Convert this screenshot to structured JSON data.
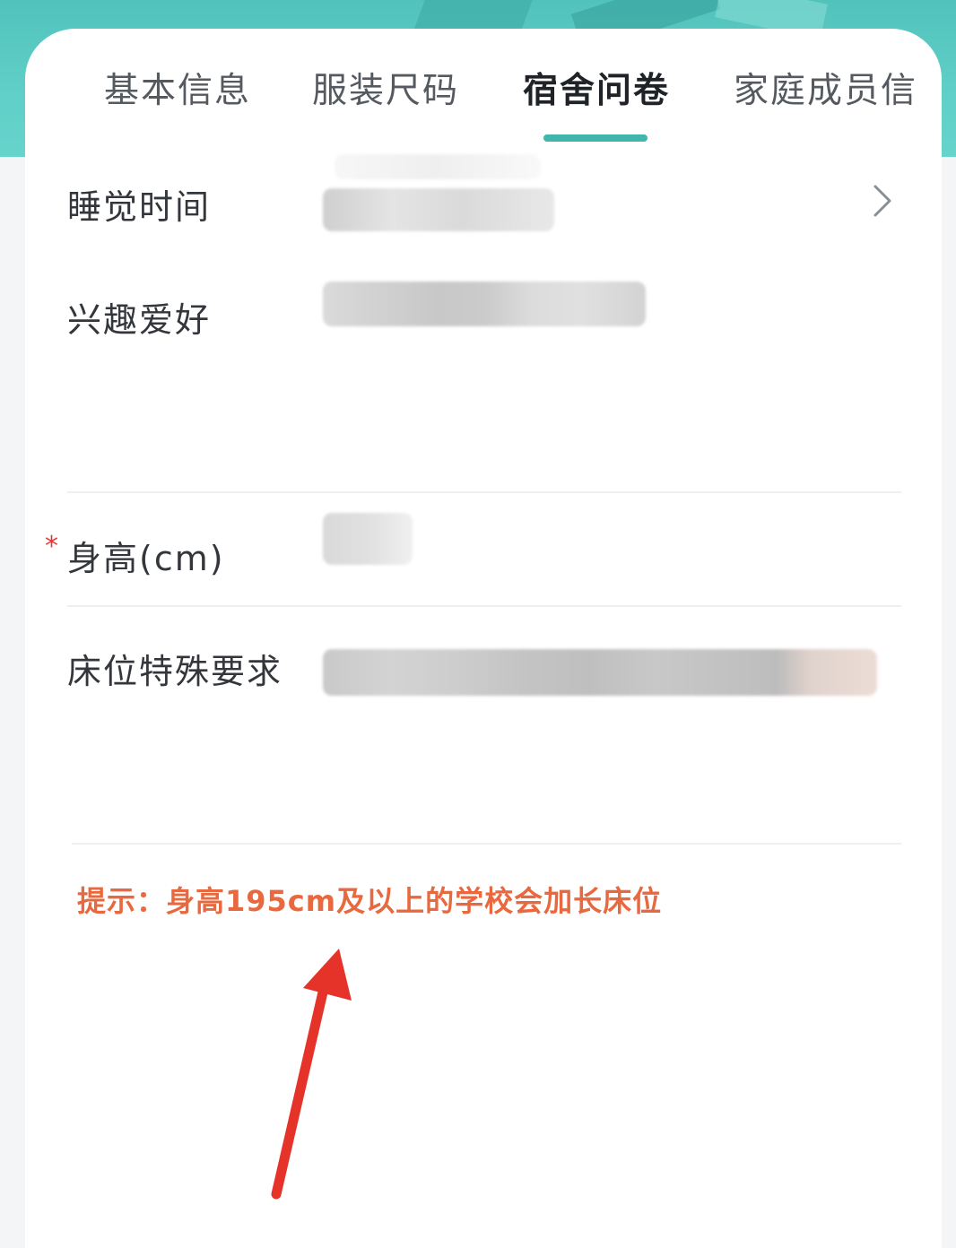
{
  "tabs": [
    {
      "label": "基本信息",
      "active": false
    },
    {
      "label": "服装尺码",
      "active": false
    },
    {
      "label": "宿舍问卷",
      "active": true
    },
    {
      "label": "家庭成员信",
      "active": false
    }
  ],
  "fields": {
    "sleep_time": {
      "label": "睡觉时间",
      "icon": "chevron-right-icon"
    },
    "hobbies": {
      "label": "兴趣爱好"
    },
    "height": {
      "label": "身高(cm)",
      "required_mark": "*"
    },
    "bed_request": {
      "label": "床位特殊要求"
    }
  },
  "hint": {
    "text": "提示：身高195cm及以上的学校会加长床位"
  },
  "colors": {
    "accent": "#3fb5ad",
    "header_bg": "#5fcfc7",
    "hint": "#e8683f",
    "required": "#e53935",
    "arrow": "#e5332a"
  }
}
